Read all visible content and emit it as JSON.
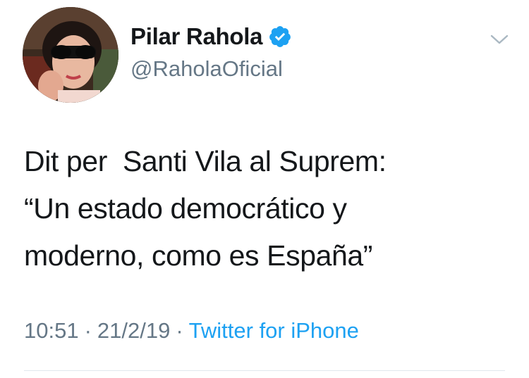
{
  "author": {
    "display_name": "Pilar Rahola",
    "handle": "@RaholaOficial",
    "verified": true,
    "avatar_icon": "profile-photo"
  },
  "tweet": {
    "lines": [
      "Dit per  Santi Vila al Suprem:",
      "“Un estado democrático y",
      "moderno, como es España”"
    ]
  },
  "meta": {
    "time": "10:51",
    "separator": "·",
    "date": "21/2/19",
    "source": "Twitter for iPhone"
  },
  "icons": {
    "menu": "chevron-down-icon",
    "verified": "verified-badge-icon"
  },
  "colors": {
    "accent": "#1da1f2",
    "text": "#14171a",
    "secondary": "#657786",
    "divider": "#e1e8ed"
  }
}
